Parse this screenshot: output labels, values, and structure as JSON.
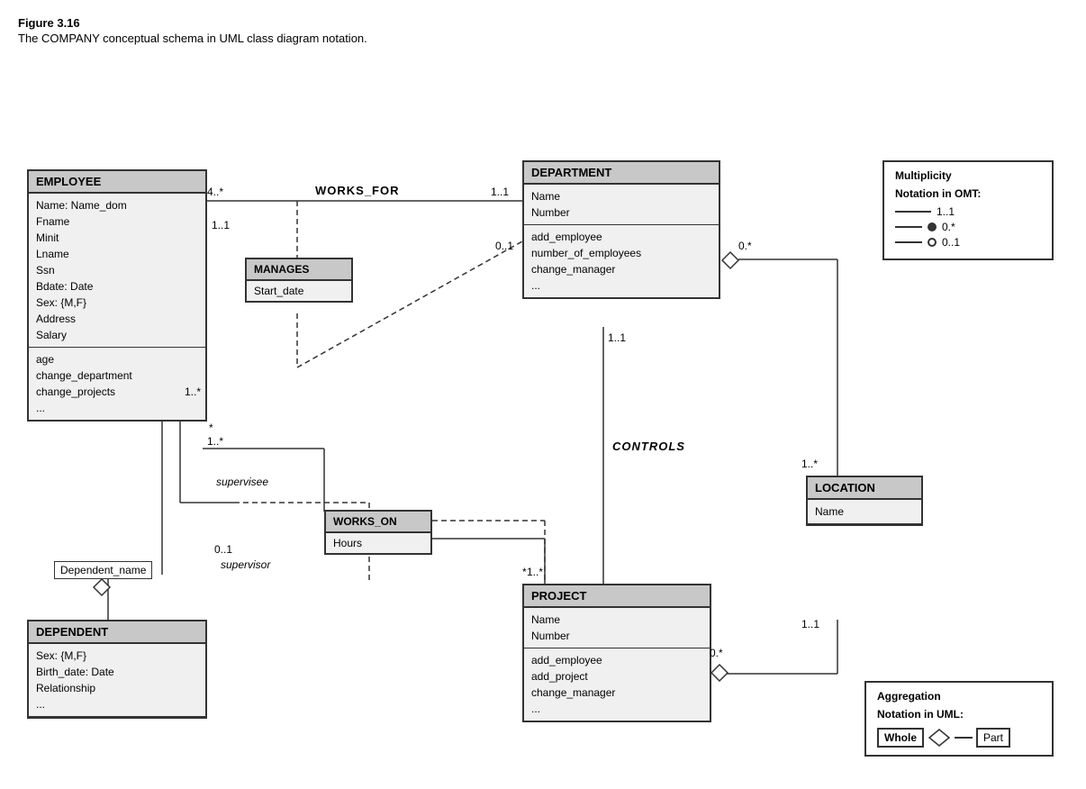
{
  "figure": {
    "title": "Figure 3.16",
    "caption": "The COMPANY conceptual schema in UML class diagram notation."
  },
  "classes": {
    "employee": {
      "name": "EMPLOYEE",
      "attrs": "Name: Name_dom\n  Fname\n  Minit\n  Lname\nSsn\nBdate: Date\nSex: {M,F}\nAddress\nSalary",
      "methods": "age\nchange_department\nchange_projects\n..."
    },
    "department": {
      "name": "DEPARTMENT",
      "attrs": "Name\nNumber",
      "methods": "add_employee\nnumber_of_employees\nchange_manager\n..."
    },
    "project": {
      "name": "PROJECT",
      "attrs": "Name\nNumber",
      "methods": "add_employee\nadd_project\nchange_manager\n..."
    },
    "location": {
      "name": "LOCATION",
      "attrs": "Name"
    },
    "dependent": {
      "name": "DEPENDENT",
      "attrs": "Sex: {M,F}\nBirth_date: Date\nRelationship\n..."
    }
  },
  "associations": {
    "manages": {
      "name": "MANAGES",
      "attrs": "Start_date"
    },
    "works_on": {
      "name": "WORKS_ON",
      "attrs": "Hours"
    }
  },
  "labels": {
    "works_for": "WORKS_FOR",
    "controls": "CONTROLS",
    "dependent_name": "Dependent_name",
    "supervisee": "supervisee",
    "supervisor": "supervisor"
  },
  "multiplicities": {
    "works_for_emp": "4..*",
    "works_for_dept": "1..1",
    "manages_emp": "1..1",
    "manages_dept": "0..1",
    "supervises_supervisee": "*",
    "supervises_emp": "1..*",
    "supervises_supervisor": "0..1",
    "works_on_emp": "1..*",
    "works_on_proj": "*",
    "dept_controls": "1..1",
    "proj_controls": "1..*",
    "dept_location": "0.*",
    "location_dept": "1..*",
    "location_proj": "1..1",
    "proj_location": "0.*"
  },
  "notation": {
    "title1": "Multiplicity",
    "title2": "Notation in OMT:",
    "row1_label": "1..1",
    "row2_label": "0.*",
    "row3_label": "0..1"
  },
  "aggregation": {
    "title1": "Aggregation",
    "title2": "Notation in UML:",
    "whole_label": "Whole",
    "part_label": "Part"
  }
}
